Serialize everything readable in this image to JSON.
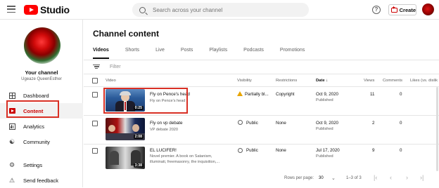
{
  "header": {
    "logo_text": "Studio",
    "search_placeholder": "Search across your channel",
    "help_label": "?",
    "create_label": "Create"
  },
  "sidebar": {
    "channel_label": "Your channel",
    "channel_name": "Ugeaze QueenEsther",
    "items": [
      {
        "label": "Dashboard",
        "icon": "dashboard-icon"
      },
      {
        "label": "Content",
        "icon": "content-play-icon",
        "active": true
      },
      {
        "label": "Analytics",
        "icon": "analytics-icon"
      },
      {
        "label": "Community",
        "icon": "community-icon"
      },
      {
        "label": "Settings",
        "icon": "gear-icon"
      },
      {
        "label": "Send feedback",
        "icon": "feedback-icon"
      }
    ]
  },
  "main": {
    "title": "Channel content",
    "tabs": [
      "Videos",
      "Shorts",
      "Live",
      "Posts",
      "Playlists",
      "Podcasts",
      "Promotions"
    ],
    "active_tab": "Videos",
    "filter_placeholder": "Filter",
    "columns": {
      "video": "Video",
      "visibility": "Visibility",
      "restrictions": "Restrictions",
      "date": "Date",
      "date_sort_icon": "arrow-down-icon",
      "views": "Views",
      "comments": "Comments",
      "likes": "Likes (vs. dislik"
    },
    "rows": [
      {
        "title": "Fly on Pence's head",
        "description": "Fly on Pence's head",
        "duration": "0:25",
        "visibility": "Partially bl...",
        "visibility_icon": "warning-icon",
        "restrictions": "Copyright",
        "date": "Oct 9, 2020",
        "status": "Published",
        "views": "11",
        "comments": "0"
      },
      {
        "title": "Fly on vp debate",
        "description": "VP debate 2020",
        "duration": "2:08",
        "visibility": "Public",
        "visibility_icon": "globe-icon",
        "restrictions": "None",
        "date": "Oct 9, 2020",
        "status": "Published",
        "views": "2",
        "comments": "0"
      },
      {
        "title": "EL LUCIFER!",
        "description_lines": [
          "Novel premier. A book on Satanism,",
          "illuminati, freemasonry, the inquisition,..."
        ],
        "duration": "3:38",
        "visibility": "Public",
        "visibility_icon": "globe-icon",
        "restrictions": "None",
        "date": "Jul 17, 2020",
        "status": "Published",
        "views": "9",
        "comments": "0"
      }
    ],
    "pager": {
      "rows_per_page_label": "Rows per page:",
      "rows_per_page": "30",
      "range": "1–3 of 3"
    }
  },
  "colors": {
    "brand_red": "#ff0000",
    "highlight_box": "#d93025",
    "warning": "#e8a500"
  }
}
